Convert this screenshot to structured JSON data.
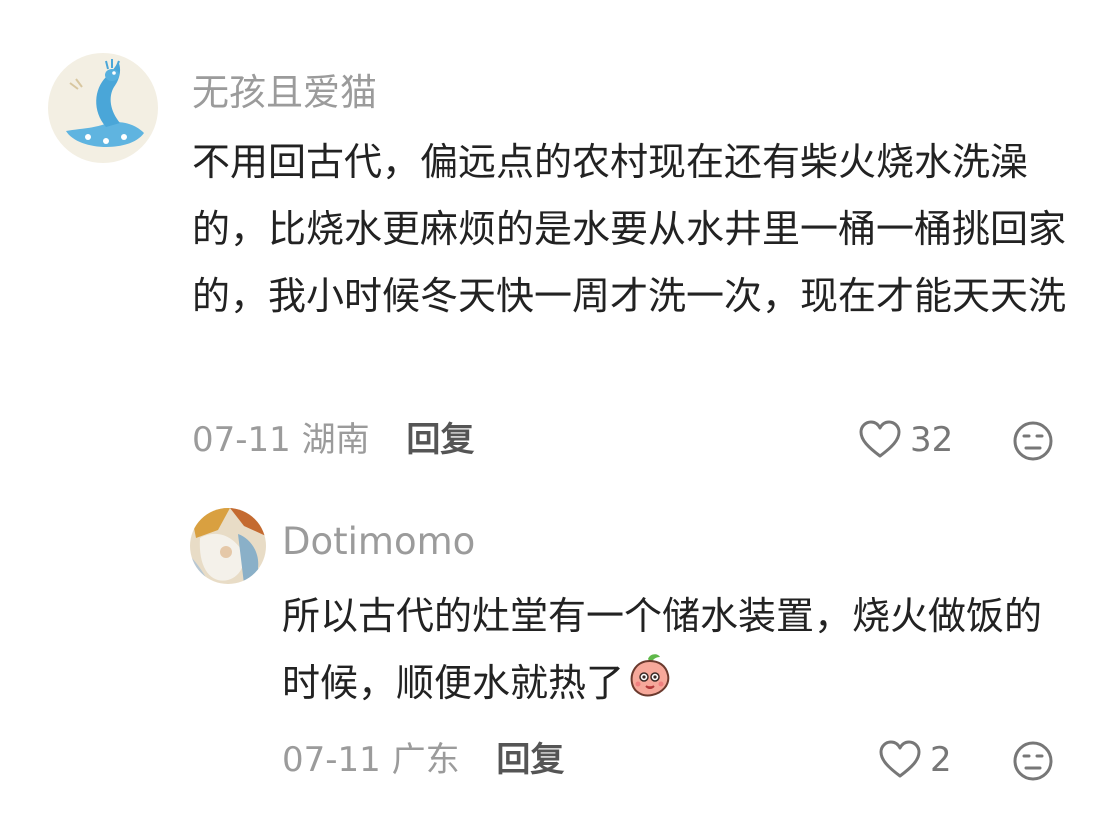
{
  "comments": [
    {
      "username": "无孩且爱猫",
      "text": "不用回古代，偏远点的农村现在还有柴火烧水洗澡的，比烧水更麻烦的是水要从水井里一桶一桶挑回家的，我小时候冬天快一周才洗一次，现在才能天天洗",
      "date": "07-11",
      "location": "湖南",
      "reply_label": "回复",
      "likes": "32",
      "avatar_icon": "peacock-avatar",
      "like_icon": "heart-outline-icon",
      "dislike_icon": "dislike-face-icon"
    }
  ],
  "replies": [
    {
      "username": "Dotimomo",
      "text": "所以古代的灶堂有一个储水装置，烧火做饭的时候，顺便水就热了",
      "emoji": "peach-emoji",
      "date": "07-11",
      "location": "广东",
      "reply_label": "回复",
      "likes": "2",
      "avatar_icon": "painting-avatar",
      "like_icon": "heart-outline-icon",
      "dislike_icon": "dislike-face-icon"
    }
  ],
  "colors": {
    "username": "#9b9b9b",
    "text": "#222222",
    "meta": "#9b9b9b",
    "icon": "#777777"
  }
}
